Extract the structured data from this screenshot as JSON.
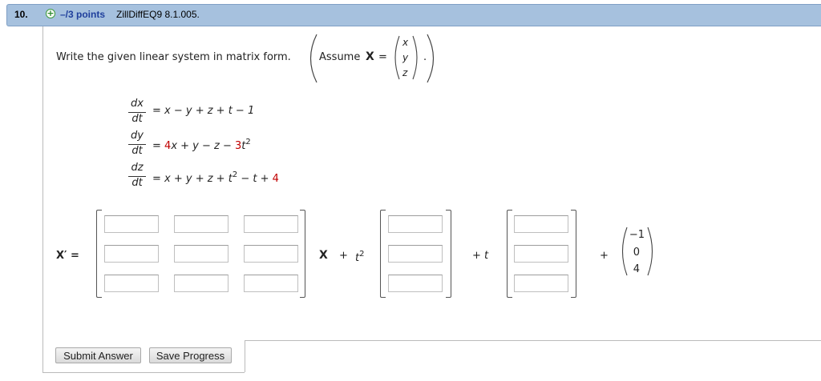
{
  "header": {
    "question_number": "10.",
    "points": "–/3 points",
    "question_id": "ZillDiffEQ9 8.1.005."
  },
  "prompt": {
    "text": "Write the given linear system in matrix form.",
    "assume_label": "Assume",
    "bold_X": "X",
    "equals": "=",
    "vector": [
      "x",
      "y",
      "z"
    ],
    "period": "."
  },
  "equations": [
    {
      "num": "dx",
      "den": "dt",
      "parts": [
        {
          "t": "= x − y + z + t − 1",
          "c": ""
        }
      ]
    },
    {
      "num": "dy",
      "den": "dt",
      "parts": [
        {
          "t": "= ",
          "c": ""
        },
        {
          "t": "4",
          "c": "red"
        },
        {
          "t": "x + y − z − ",
          "c": ""
        },
        {
          "t": "3",
          "c": "red"
        },
        {
          "t": "t",
          "c": ""
        },
        {
          "t": "2",
          "c": "sup"
        }
      ]
    },
    {
      "num": "dz",
      "den": "dt",
      "parts": [
        {
          "t": "= x + y + z + t",
          "c": ""
        },
        {
          "t": "2",
          "c": "sup"
        },
        {
          "t": " − t + ",
          "c": ""
        },
        {
          "t": "4",
          "c": "red"
        }
      ]
    }
  ],
  "matrix_form": {
    "lhs": "X′ =",
    "x_label": "X",
    "plus": "+",
    "t2": "t",
    "t2_exp": "2",
    "plus_t": "+ t",
    "plus2": "+",
    "constant_vector": [
      "−1",
      "0",
      "4"
    ]
  },
  "buttons": {
    "submit": "Submit Answer",
    "save": "Save Progress"
  },
  "colors": {
    "header_bg": "#a6c1de",
    "points_text": "#1f3f9c",
    "accent_red": "#c00000"
  }
}
